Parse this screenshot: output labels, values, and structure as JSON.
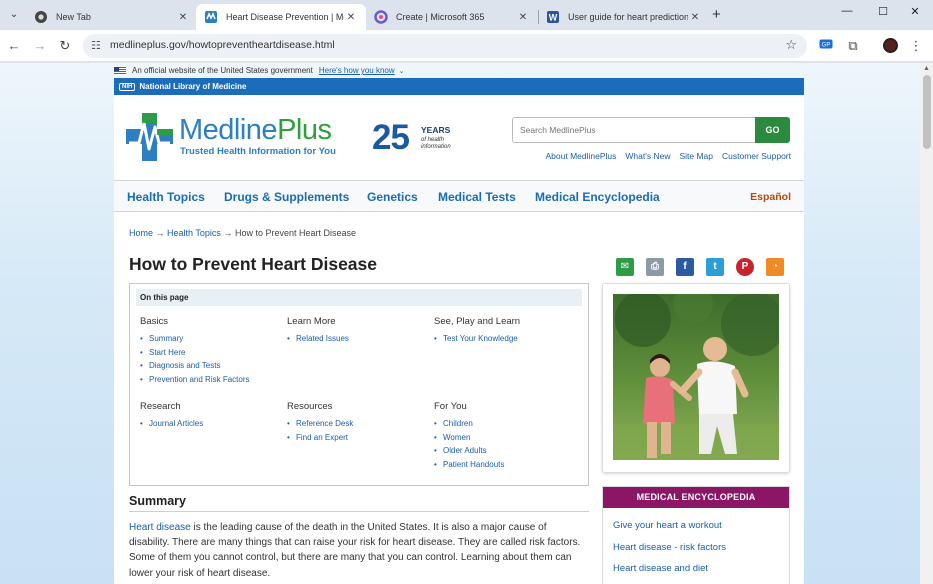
{
  "browser": {
    "tabs": [
      {
        "title": "New Tab",
        "active": false
      },
      {
        "title": "Heart Disease Prevention | Med",
        "active": true
      },
      {
        "title": "Create | Microsoft 365",
        "active": false
      },
      {
        "title": "User guide for heart prediction",
        "active": false
      }
    ],
    "url": "medlineplus.gov/howtopreventheartdisease.html",
    "window_controls": {
      "minimize": "—",
      "maximize": "☐",
      "close": "✕"
    },
    "new_tab": "+"
  },
  "gov_banner": {
    "text": "An official website of the United States government",
    "link": "Here's how you know"
  },
  "nlm_bar": {
    "badge": "NIH",
    "label": "National Library of Medicine"
  },
  "header": {
    "logo_medline": "Medline",
    "logo_plus": "Plus",
    "tagline": "Trusted Health Information for You",
    "anniversary_number": "25",
    "anniversary_years": "YEARS",
    "anniversary_sub": "of health information",
    "search_placeholder": "Search MedlinePlus",
    "search_button": "GO",
    "util_links": [
      "About MedlinePlus",
      "What's New",
      "Site Map",
      "Customer Support"
    ]
  },
  "nav": {
    "items": [
      "Health Topics",
      "Drugs & Supplements",
      "Genetics",
      "Medical Tests",
      "Medical Encyclopedia"
    ],
    "espanol": "Español"
  },
  "breadcrumb": {
    "home": "Home",
    "health_topics": "Health Topics",
    "current": "How to Prevent Heart Disease",
    "separator": "→"
  },
  "page_title": "How to Prevent Heart Disease",
  "share_icons": [
    {
      "name": "email-icon",
      "color": "#2e9b45"
    },
    {
      "name": "print-icon",
      "color": "#8a9aa6"
    },
    {
      "name": "facebook-icon",
      "color": "#2c5aa0"
    },
    {
      "name": "twitter-icon",
      "color": "#2a9fd6"
    },
    {
      "name": "pinterest-icon",
      "color": "#c8232c"
    },
    {
      "name": "rss-icon",
      "color": "#f08a24"
    }
  ],
  "on_this_page": {
    "heading": "On this page",
    "sections": [
      {
        "title": "Basics",
        "links": [
          "Summary",
          "Start Here",
          "Diagnosis and Tests",
          "Prevention and Risk Factors"
        ]
      },
      {
        "title": "Learn More",
        "links": [
          "Related Issues"
        ]
      },
      {
        "title": "See, Play and Learn",
        "links": [
          "Test Your Knowledge"
        ]
      },
      {
        "title": "Research",
        "links": [
          "Journal Articles"
        ]
      },
      {
        "title": "Resources",
        "links": [
          "Reference Desk",
          "Find an Expert"
        ]
      },
      {
        "title": "For You",
        "links": [
          "Children",
          "Women",
          "Older Adults",
          "Patient Handouts"
        ]
      }
    ]
  },
  "summary": {
    "title": "Summary",
    "link_text": "Heart disease",
    "text": " is the leading cause of the death in the United States. It is also a major cause of disability. There are many things that can raise your risk for heart disease. They are called risk factors. Some of them you cannot control, but there are many that you can control. Learning about them can lower your risk of heart disease."
  },
  "encyclopedia": {
    "heading": "MEDICAL ENCYCLOPEDIA",
    "links": [
      "Give your heart a workout",
      "Heart disease - risk factors",
      "Heart disease and diet"
    ]
  }
}
